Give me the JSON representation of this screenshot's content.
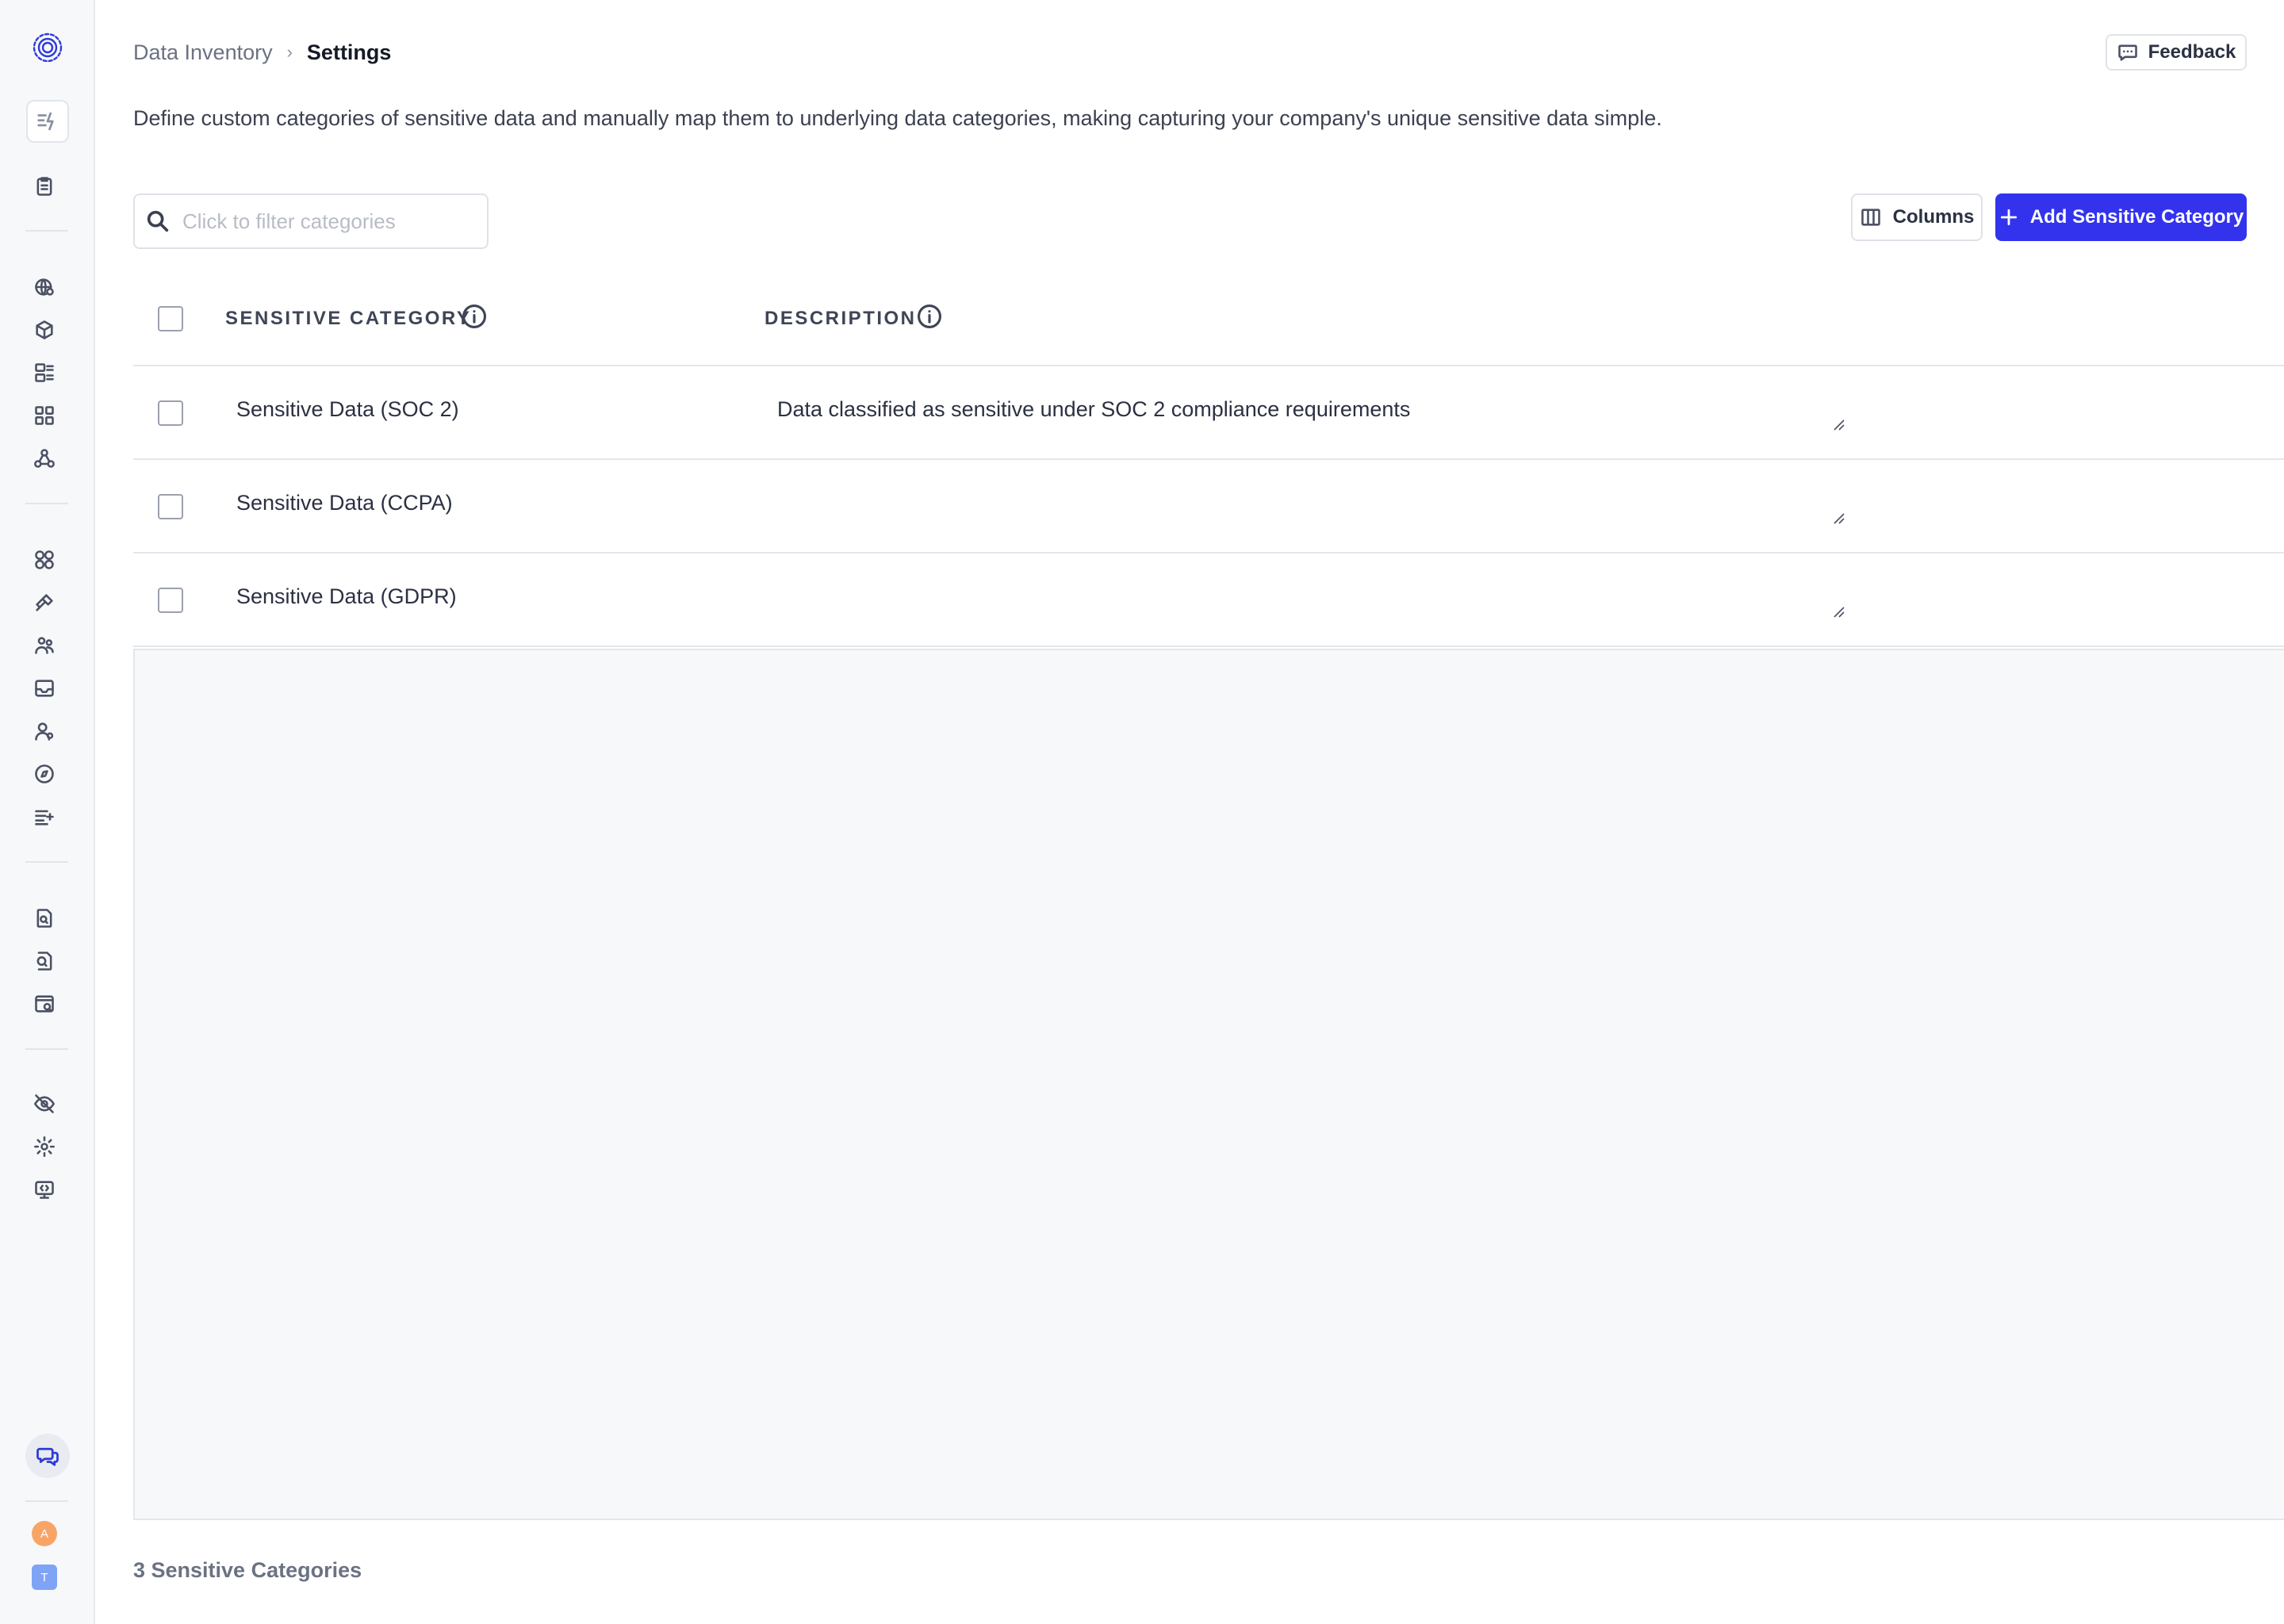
{
  "sidebar": {
    "avatar_user": "A",
    "avatar_team": "T",
    "icons": [
      "logo-icon",
      "quick-actions-icon",
      "clipboard-icon",
      "globe-icon",
      "cube-icon",
      "data-grid-icon",
      "apps-icon",
      "network-icon",
      "integrations-icon",
      "connector-icon",
      "users-icon",
      "inbox-icon",
      "person-icon",
      "compass-icon",
      "list-plus-icon",
      "document-search-icon",
      "file-scan-icon",
      "browser-search-icon",
      "eye-off-icon",
      "gear-icon",
      "code-monitor-icon",
      "chat-icon"
    ]
  },
  "header": {
    "breadcrumb_parent": "Data Inventory",
    "breadcrumb_separator": "›",
    "breadcrumb_current": "Settings",
    "feedback_label": "Feedback"
  },
  "intro_text": "Define custom categories of sensitive data and manually map them to underlying data categories, making capturing your company's unique sensitive data simple.",
  "toolbar": {
    "search_placeholder": "Click to filter categories",
    "search_value": "",
    "columns_label": "Columns",
    "add_label": "Add Sensitive Category"
  },
  "table": {
    "columns": [
      "SENSITIVE CATEGORY",
      "DESCRIPTION"
    ],
    "rows": [
      {
        "name": "Sensitive Data (SOC 2)",
        "description": "Data classified as sensitive under SOC 2 compliance requirements"
      },
      {
        "name": "Sensitive Data (CCPA)",
        "description": ""
      },
      {
        "name": "Sensitive Data (GDPR)",
        "description": ""
      }
    ]
  },
  "footer": {
    "count_label": "3 Sensitive Categories"
  },
  "colors": {
    "accent": "#3333ee",
    "sidebar_bg": "#f7f8fa",
    "avatar_user": "#f7a567",
    "avatar_team": "#7fa3f5"
  }
}
